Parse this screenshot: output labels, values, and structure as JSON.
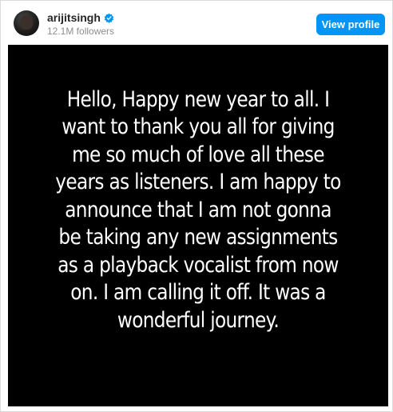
{
  "header": {
    "username": "arijitsingh",
    "followers": "12.1M followers",
    "view_profile_label": "View profile",
    "avatar_icon": "profile-avatar",
    "verified_icon": "verified-badge-icon"
  },
  "post": {
    "text": "Hello, Happy new year to all. I want to thank you all for giving me so much of love all these years as listeners. I am happy to announce that I am not gonna be taking any new assignments as a playback vocalist from now on. I am calling it off. It was a wonderful journey."
  },
  "colors": {
    "accent": "#0095f6",
    "post_background": "#000000",
    "post_text": "#ffffff",
    "username": "#262626",
    "muted": "#8e8e8e"
  }
}
